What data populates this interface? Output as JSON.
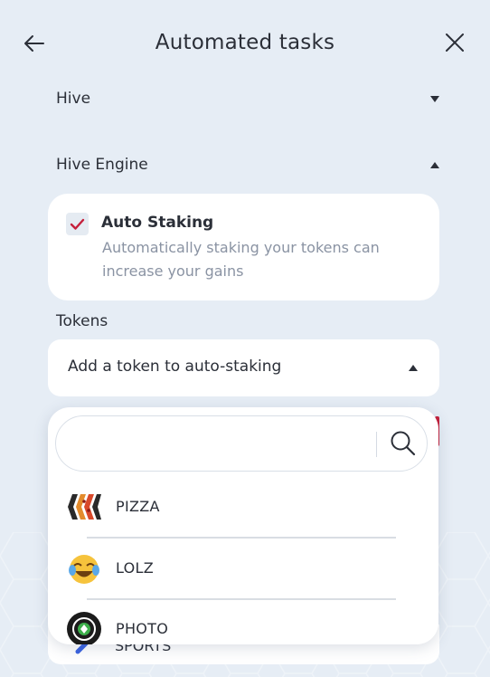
{
  "header": {
    "title": "Automated tasks",
    "back_icon": "arrow-left-icon",
    "close_icon": "close-icon"
  },
  "sections": {
    "hive": {
      "label": "Hive",
      "state": "collapsed"
    },
    "hive_engine": {
      "label": "Hive Engine",
      "state": "expanded"
    }
  },
  "auto_staking": {
    "title": "Auto Staking",
    "description": "Automatically staking your tokens can increase your gains",
    "checked": true,
    "check_color": "#c5203b"
  },
  "tokens": {
    "label": "Tokens",
    "select_label": "Add a token to auto-staking",
    "behind_item": "SPORTS"
  },
  "dropdown": {
    "search_value": "",
    "search_icon": "search-icon",
    "items": [
      {
        "name": "PIZZA",
        "icon": "pizza-logo-icon"
      },
      {
        "name": "LOLZ",
        "icon": "laughing-emoji-icon"
      },
      {
        "name": "PHOTO",
        "icon": "photo-logo-icon"
      }
    ]
  },
  "colors": {
    "background": "#e6edf5",
    "card": "#ffffff",
    "accent": "#c5203b",
    "muted_text": "#8a93a3"
  }
}
